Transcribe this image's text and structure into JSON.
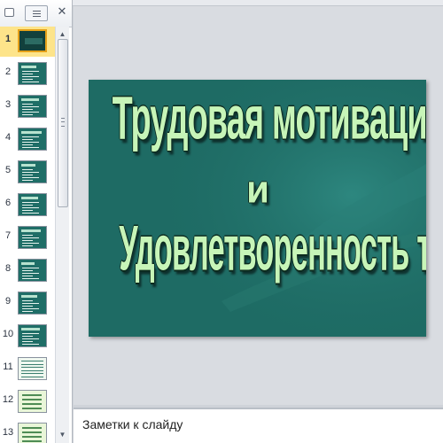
{
  "pane": {
    "close_glyph": "✕",
    "slides": [
      {
        "number": "1"
      },
      {
        "number": "2"
      },
      {
        "number": "3"
      },
      {
        "number": "4"
      },
      {
        "number": "5"
      },
      {
        "number": "6"
      },
      {
        "number": "7"
      },
      {
        "number": "8"
      },
      {
        "number": "9"
      },
      {
        "number": "10"
      },
      {
        "number": "11"
      },
      {
        "number": "12"
      },
      {
        "number": "13"
      }
    ],
    "selected_slide": "1",
    "scroll_up": "▲",
    "scroll_down": "▼"
  },
  "slide": {
    "line1": "Трудовая мотивация",
    "line2": "и",
    "line3": "Удовлетворенность трудом",
    "background_color": "#1e6b64",
    "text_color": "#c7f5b8"
  },
  "notes": {
    "placeholder": "Заметки к слайду"
  }
}
